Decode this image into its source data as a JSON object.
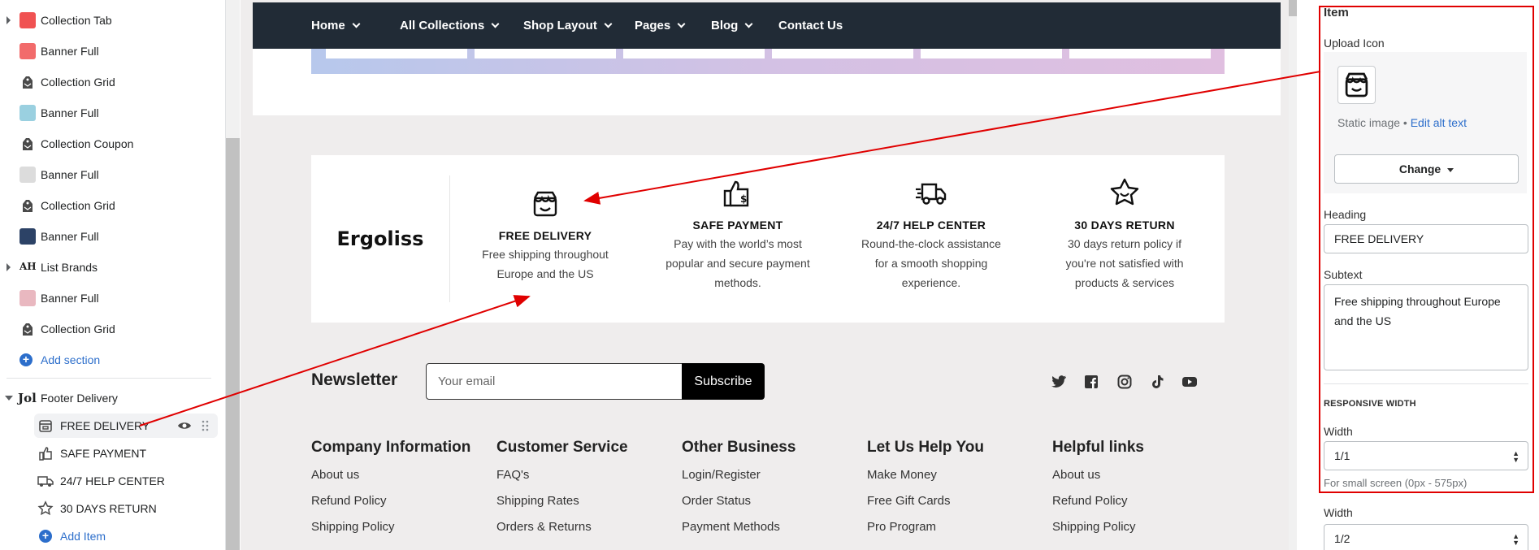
{
  "sidebar": {
    "sections": [
      {
        "label": "Collection Tab",
        "thumb": "collection-tab-thumb",
        "color": "#f05252",
        "caret": true
      },
      {
        "label": "Banner Full",
        "thumb": "banner-thumb",
        "color": "#f26b6b",
        "caret": false
      },
      {
        "label": "Collection Grid",
        "thumb": "tag-icon",
        "color": "#4a4a4a",
        "caret": false
      },
      {
        "label": "Banner Full",
        "thumb": "banner-thumb",
        "color": "#9ad0e0",
        "caret": false
      },
      {
        "label": "Collection Coupon",
        "thumb": "tag-icon",
        "color": "#4a4a4a",
        "caret": false
      },
      {
        "label": "Banner Full",
        "thumb": "banner-thumb",
        "color": "#dcdcdc",
        "caret": false
      },
      {
        "label": "Collection Grid",
        "thumb": "tag-icon",
        "color": "#4a4a4a",
        "caret": false
      },
      {
        "label": "Banner Full",
        "thumb": "banner-thumb",
        "color": "#2c4266",
        "caret": false
      },
      {
        "label": "List Brands",
        "thumb": "brand-thumb",
        "color": "#333333",
        "caret": true
      },
      {
        "label": "Banner Full",
        "thumb": "banner-thumb",
        "color": "#e9b8c0",
        "caret": false
      },
      {
        "label": "Collection Grid",
        "thumb": "tag-icon",
        "color": "#4a4a4a",
        "caret": false
      }
    ],
    "add_section": "Add section",
    "footer_section": "Footer Delivery",
    "footer_items": [
      "FREE DELIVERY",
      "SAFE PAYMENT",
      "24/7 HELP CENTER",
      "30 DAYS RETURN"
    ],
    "add_item": "Add Item"
  },
  "preview": {
    "nav": [
      "Home",
      "All Collections",
      "Shop Layout",
      "Pages",
      "Blog",
      "Contact Us"
    ],
    "brand": "Ergoliss",
    "features": [
      {
        "title": "FREE DELIVERY",
        "text": "Free shipping throughout Europe and the US",
        "icon": "store-icon"
      },
      {
        "title": "SAFE PAYMENT",
        "text": "Pay with the world’s most popular and secure payment methods.",
        "icon": "payment-icon"
      },
      {
        "title": "24/7 HELP CENTER",
        "text": "Round-the-clock assistance for a smooth shopping experience.",
        "icon": "truck-icon"
      },
      {
        "title": "30 DAYS RETURN",
        "text": "30 days return policy if you're not satisfied with products & services",
        "icon": "star-badge-icon"
      }
    ],
    "newsletter_label": "Newsletter",
    "email_placeholder": "Your email",
    "subscribe": "Subscribe",
    "social": [
      "twitter-icon",
      "facebook-icon",
      "instagram-icon",
      "tiktok-icon",
      "youtube-icon"
    ],
    "footer_columns": [
      {
        "heading": "Company Information",
        "links": [
          "About us",
          "Refund Policy",
          "Shipping Policy"
        ]
      },
      {
        "heading": "Customer Service",
        "links": [
          "FAQ's",
          "Shipping Rates",
          "Orders & Returns"
        ]
      },
      {
        "heading": "Other Business",
        "links": [
          "Login/Register",
          "Order Status",
          "Payment Methods"
        ]
      },
      {
        "heading": "Let Us Help You",
        "links": [
          "Make Money",
          "Free Gift Cards",
          "Pro Program"
        ]
      },
      {
        "heading": "Helpful links",
        "links": [
          "About us",
          "Refund Policy",
          "Shipping Policy"
        ]
      }
    ]
  },
  "panel": {
    "item_title": "Item",
    "upload_label": "Upload Icon",
    "static_image": "Static image •",
    "edit_alt": "Edit alt text",
    "change": "Change",
    "heading_label": "Heading",
    "heading_value": "FREE DELIVERY",
    "subtext_label": "Subtext",
    "subtext_value": "Free shipping throughout Europe and the US",
    "responsive_width": "RESPONSIVE WIDTH",
    "width_label": "Width",
    "width_value": "1/1",
    "width_hint": "For small screen (0px - 575px)",
    "width2_label": "Width",
    "width2_value": "1/2"
  },
  "colors": {
    "accent_link": "#2c6ecb",
    "annotation_red": "#e00000",
    "nav_bg": "#212b36"
  }
}
